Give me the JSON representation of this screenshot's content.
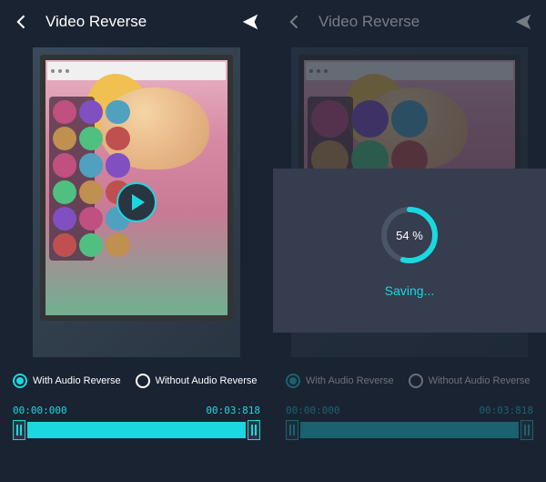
{
  "colors": {
    "accent": "#1BD8E0",
    "bg": "#1a2332",
    "modal": "#353d4f"
  },
  "header": {
    "title": "Video Reverse"
  },
  "player": {
    "start_time": "00:00:000",
    "end_time": "00:03:818"
  },
  "audio_options": {
    "with": "With Audio Reverse",
    "without": "Without Audio  Reverse",
    "selected": "with"
  },
  "save_modal": {
    "percent_value": 54,
    "percent_label": "54 %",
    "status": "Saving..."
  }
}
